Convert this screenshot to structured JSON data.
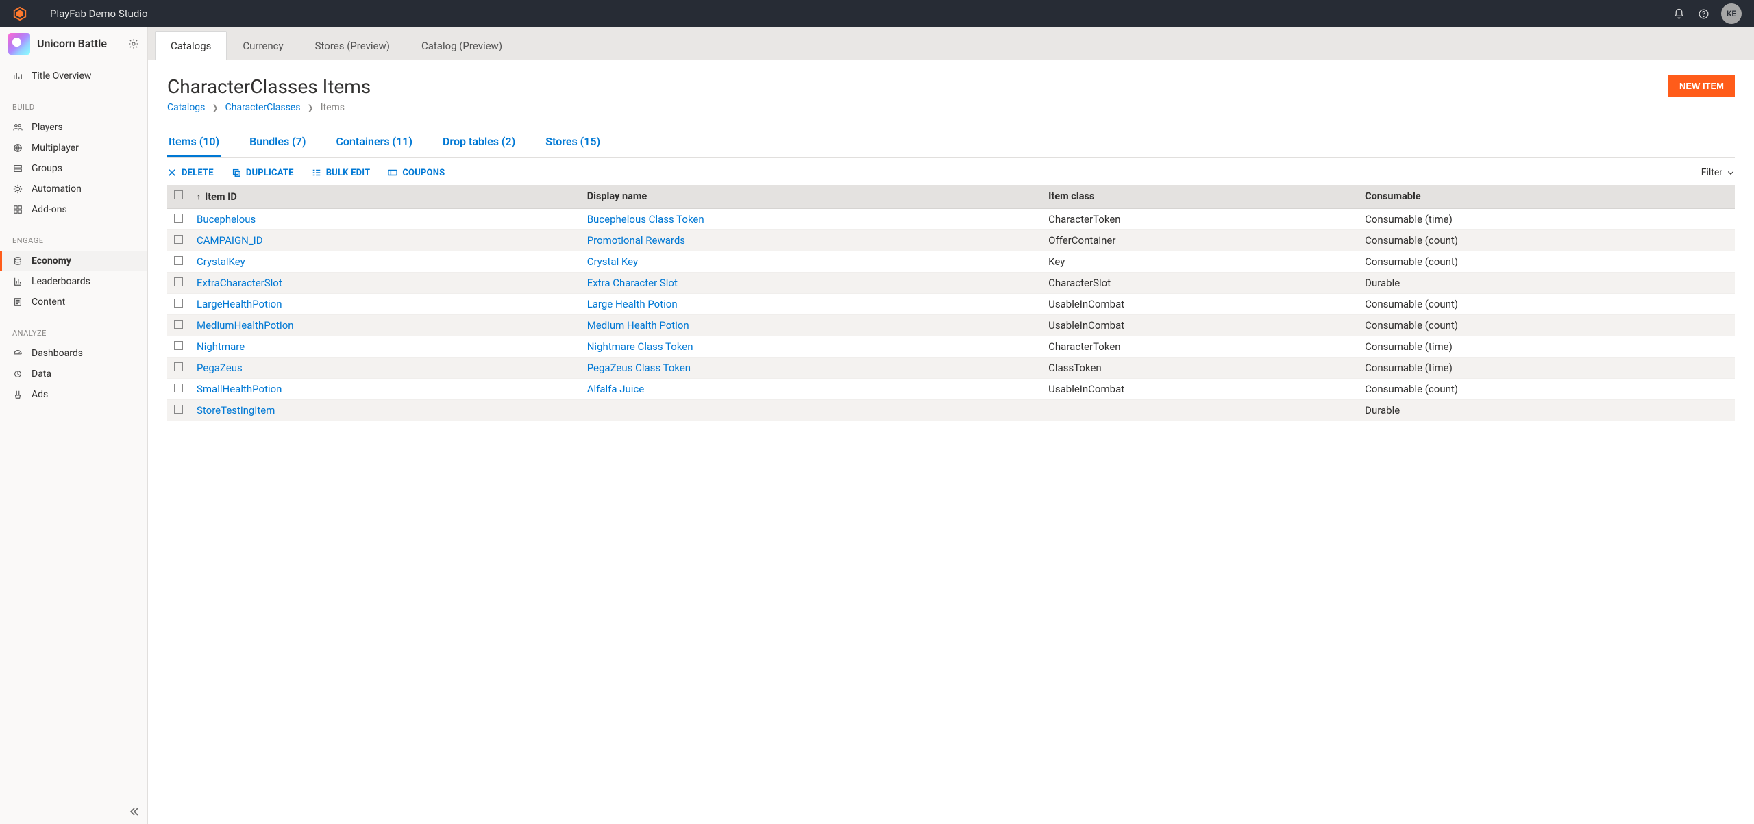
{
  "topbar": {
    "studio": "PlayFab Demo Studio",
    "avatar": "KE"
  },
  "sidebar": {
    "title": "Unicorn Battle",
    "overview": "Title Overview",
    "sections": {
      "build": {
        "label": "BUILD",
        "items": [
          "Players",
          "Multiplayer",
          "Groups",
          "Automation",
          "Add-ons"
        ]
      },
      "engage": {
        "label": "ENGAGE",
        "items": [
          "Economy",
          "Leaderboards",
          "Content"
        ],
        "activeIndex": 0
      },
      "analyze": {
        "label": "ANALYZE",
        "items": [
          "Dashboards",
          "Data",
          "Ads"
        ]
      }
    }
  },
  "tabs": {
    "items": [
      "Catalogs",
      "Currency",
      "Stores (Preview)",
      "Catalog (Preview)"
    ],
    "activeIndex": 0
  },
  "page": {
    "title": "CharacterClasses Items",
    "new_button": "NEW ITEM",
    "breadcrumbs": {
      "a": "Catalogs",
      "b": "CharacterClasses",
      "c": "Items"
    }
  },
  "subtabs": {
    "items": [
      "Items (10)",
      "Bundles (7)",
      "Containers (11)",
      "Drop tables (2)",
      "Stores (15)"
    ],
    "activeIndex": 0
  },
  "toolbar": {
    "delete": "DELETE",
    "duplicate": "DUPLICATE",
    "bulkedit": "BULK EDIT",
    "coupons": "COUPONS",
    "filter": "Filter"
  },
  "table": {
    "headers": {
      "itemid": "Item ID",
      "display": "Display name",
      "class": "Item class",
      "consumable": "Consumable"
    },
    "rows": [
      {
        "id": "Bucephelous",
        "name": "Bucephelous Class Token",
        "class": "CharacterToken",
        "consumable": "Consumable (time)"
      },
      {
        "id": "CAMPAIGN_ID",
        "name": "Promotional Rewards",
        "class": "OfferContainer",
        "consumable": "Consumable (count)"
      },
      {
        "id": "CrystalKey",
        "name": "Crystal Key",
        "class": "Key",
        "consumable": "Consumable (count)"
      },
      {
        "id": "ExtraCharacterSlot",
        "name": "Extra Character Slot",
        "class": "CharacterSlot",
        "consumable": "Durable"
      },
      {
        "id": "LargeHealthPotion",
        "name": "Large Health Potion",
        "class": "UsableInCombat",
        "consumable": "Consumable (count)"
      },
      {
        "id": "MediumHealthPotion",
        "name": "Medium Health Potion",
        "class": "UsableInCombat",
        "consumable": "Consumable (count)"
      },
      {
        "id": "Nightmare",
        "name": "Nightmare Class Token",
        "class": "CharacterToken",
        "consumable": "Consumable (time)"
      },
      {
        "id": "PegaZeus",
        "name": "PegaZeus Class Token",
        "class": "ClassToken",
        "consumable": "Consumable (time)"
      },
      {
        "id": "SmallHealthPotion",
        "name": "Alfalfa Juice",
        "class": "UsableInCombat",
        "consumable": "Consumable (count)"
      },
      {
        "id": "StoreTestingItem",
        "name": "",
        "class": "",
        "consumable": "Durable"
      }
    ]
  }
}
